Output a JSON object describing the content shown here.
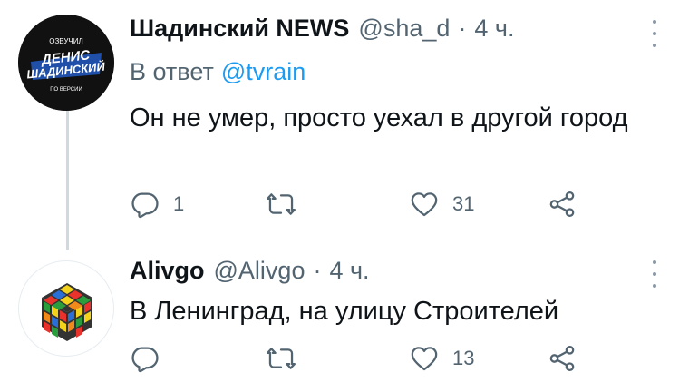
{
  "tweets": [
    {
      "display_name": "Шадинский NEWS",
      "handle": "@sha_d",
      "separator": "·",
      "time": "4 ч.",
      "reply_prefix": "В ответ",
      "reply_handle": "@tvrain",
      "text": "Он не умер, просто уехал в другой город",
      "avatar_text": {
        "top": "ОЗВУЧИЛ",
        "name1": "ДЕНИС",
        "name2": "ШАДИНСКИЙ",
        "bottom": "ПО ВЕРСИИ"
      },
      "reply_count": "1",
      "retweet_count": "",
      "like_count": "31"
    },
    {
      "display_name": "Alivgo",
      "handle": "@Alivgo",
      "separator": "·",
      "time": "4 ч.",
      "text": "В Ленинград, на улицу Строителей",
      "reply_count": "",
      "retweet_count": "",
      "like_count": "13"
    }
  ],
  "icons": {
    "reply": "reply-icon",
    "retweet": "retweet-icon",
    "like": "heart-icon",
    "share": "share-icon",
    "more": "more-icon"
  },
  "colors": {
    "link": "#1d9bf0",
    "secondary_text": "#536471",
    "thread_line": "#cfd9de"
  }
}
